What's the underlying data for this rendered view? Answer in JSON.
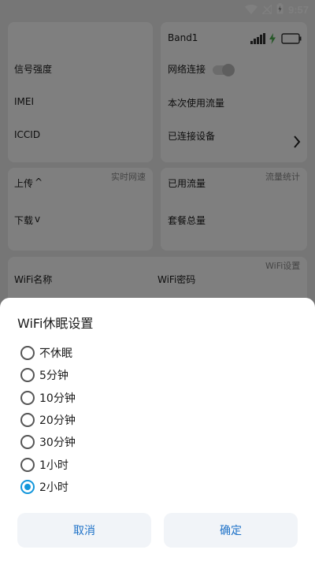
{
  "status_bar": {
    "time": "9:57",
    "icons": [
      "wifi-icon",
      "signal-off-icon",
      "battery-charging-icon"
    ]
  },
  "background_app": {
    "device_card": {
      "signal_label": "信号强度",
      "imei_label": "IMEI",
      "iccid_label": "ICCID"
    },
    "network_card": {
      "band_label": "Band1",
      "connection_label": "网络连接",
      "session_usage_label": "本次使用流量",
      "connected_devices_label": "已连接设备",
      "icons": [
        "signal-bars-icon",
        "charging-bolt-icon",
        "battery-icon",
        "chevron-right-icon"
      ]
    },
    "speed_card": {
      "tag": "实时网速",
      "upload_label": "上传",
      "download_label": "下载",
      "upload_arrow": "^",
      "download_arrow": "v"
    },
    "traffic_card": {
      "tag": "流量统计",
      "used_label": "已用流量",
      "plan_total_label": "套餐总量"
    },
    "wifi_card": {
      "tag": "WiFi设置",
      "ssid_label": "WiFi名称",
      "password_label": "WiFi密码"
    }
  },
  "dialog": {
    "title": "WiFi休眠设置",
    "options": [
      {
        "label": "不休眠",
        "checked": false
      },
      {
        "label": "5分钟",
        "checked": false
      },
      {
        "label": "10分钟",
        "checked": false
      },
      {
        "label": "20分钟",
        "checked": false
      },
      {
        "label": "30分钟",
        "checked": false
      },
      {
        "label": "1小时",
        "checked": false
      },
      {
        "label": "2小时",
        "checked": true
      }
    ],
    "cancel_label": "取消",
    "confirm_label": "确定"
  },
  "colors": {
    "accent": "#1296db",
    "button_text": "#1e72c8",
    "button_bg": "#f1f4f8",
    "charging_green": "#4caf50"
  }
}
